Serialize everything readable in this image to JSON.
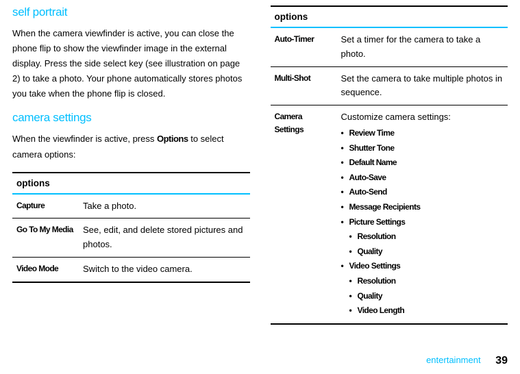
{
  "left": {
    "heading1": "self portrait",
    "para1": "When the camera viewfinder is active, you can close the phone flip to show the viewfinder image in the external display. Press the side select key (see illustration on page 2) to take a photo. Your phone automatically stores photos you take when the phone flip is closed.",
    "heading2": "camera settings",
    "para2_pre": "When the viewfinder is active, press ",
    "para2_bold": "Options",
    "para2_post": " to select camera options:",
    "table": {
      "header": "options",
      "rows": [
        {
          "name": "Capture",
          "desc": "Take a photo."
        },
        {
          "name": "Go To My Media",
          "desc": "See, edit, and delete stored pictures and photos."
        },
        {
          "name": "Video Mode",
          "desc": "Switch to the video camera."
        }
      ]
    }
  },
  "right": {
    "table": {
      "header": "options",
      "rows": [
        {
          "name": "Auto-Timer",
          "desc": "Set a timer for the camera to take a photo."
        },
        {
          "name": "Multi-Shot",
          "desc": "Set the camera to take multiple photos in sequence."
        }
      ],
      "settings_row": {
        "name": "Camera Settings",
        "desc": "Customize camera settings:",
        "bullets": [
          {
            "label": "Review Time"
          },
          {
            "label": "Shutter Tone"
          },
          {
            "label": "Default Name"
          },
          {
            "label": "Auto-Save"
          },
          {
            "label": "Auto-Send"
          },
          {
            "label": "Message Recipients"
          },
          {
            "label": "Picture Settings",
            "sub": [
              "Resolution",
              "Quality"
            ]
          },
          {
            "label": "Video Settings",
            "sub": [
              "Resolution",
              "Quality",
              "Video Length"
            ]
          }
        ]
      }
    }
  },
  "footer": {
    "section": "entertainment",
    "page": "39"
  }
}
